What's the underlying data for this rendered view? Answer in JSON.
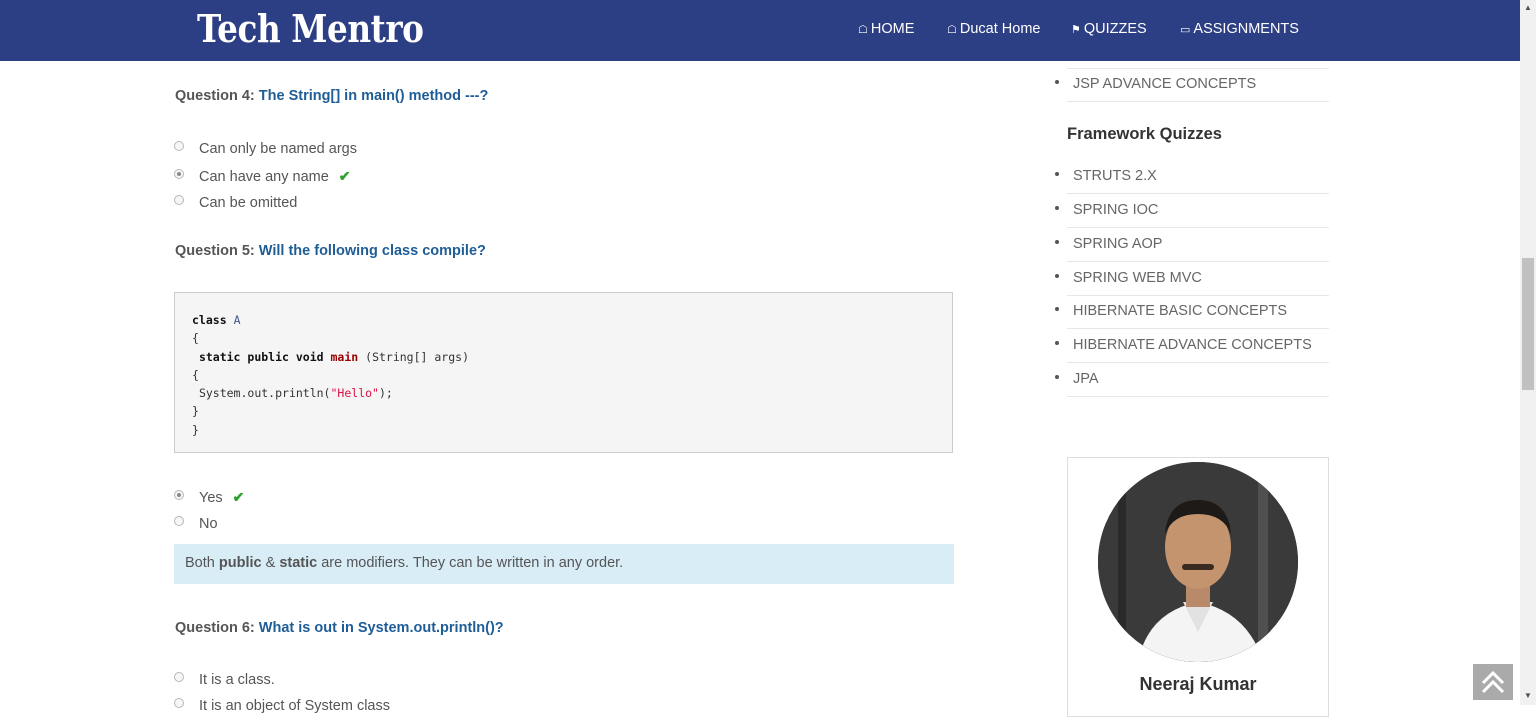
{
  "header": {
    "brand": "Tech Mentro",
    "nav": [
      {
        "label": "HOME",
        "icon": "home-icon"
      },
      {
        "label": "Ducat Home",
        "icon": "home-icon"
      },
      {
        "label": "QUIZZES",
        "icon": "puzzle-icon"
      },
      {
        "label": "ASSIGNMENTS",
        "icon": "laptop-icon"
      }
    ]
  },
  "questions": {
    "q4": {
      "num": "Question 4:",
      "text": "The String[] in main() method ---?",
      "options": [
        "Can only be named args",
        "Can have any name",
        "Can be omitted"
      ]
    },
    "q5": {
      "num": "Question 5:",
      "text": "Will the following class compile?",
      "code": {
        "l1kw": "class",
        "l1cls": "A",
        "l2": "{",
        "l3kw": "static public void",
        "l3fn": "main",
        "l3rest": "(String[] args)",
        "l4": "{",
        "l5a": "System.out.println(",
        "l5str": "\"Hello\"",
        "l5b": ");",
        "l6": "}",
        "l7": "}"
      },
      "options": [
        "Yes",
        "No"
      ],
      "note": {
        "pre": "Both",
        "b1": "public",
        "mid": "&",
        "b2": "static",
        "post": "are modifiers. They can be written in any order."
      }
    },
    "q6": {
      "num": "Question 6:",
      "text": "What is out in System.out.println()?",
      "options": [
        "It is a class.",
        "It is an object of System class"
      ]
    }
  },
  "sidebar": {
    "top_item": "JSP ADVANCE CONCEPTS",
    "framework_title": "Framework Quizzes",
    "framework_items": [
      "STRUTS 2.X",
      "SPRING IOC",
      "SPRING AOP",
      "SPRING WEB MVC",
      "HIBERNATE BASIC CONCEPTS",
      "HIBERNATE ADVANCE CONCEPTS",
      "JPA"
    ],
    "profile_name": "Neeraj Kumar"
  },
  "colors": {
    "navbar": "#2c3e84",
    "link": "#1f5d97",
    "check": "#2aa12a",
    "note_bg": "#d9edf7"
  }
}
